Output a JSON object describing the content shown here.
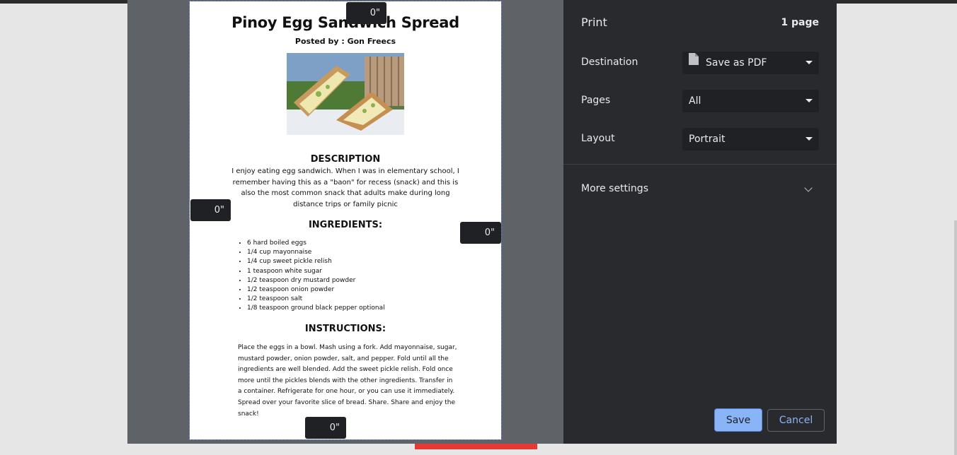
{
  "print_dialog": {
    "title": "Print",
    "page_count": "1 page",
    "destination": {
      "label": "Destination",
      "value": "Save as PDF"
    },
    "pages": {
      "label": "Pages",
      "value": "All"
    },
    "layout": {
      "label": "Layout",
      "value": "Portrait"
    },
    "more_settings": "More settings",
    "save_label": "Save",
    "cancel_label": "Cancel",
    "accent_color": "#8ab4f8"
  },
  "margins": {
    "top": "0\"",
    "left": "0\"",
    "right": "0\"",
    "bottom": "0\""
  },
  "document": {
    "title": "Pinoy Egg Sandwich Spread",
    "author": "Posted by : Gon Freecs",
    "description_heading": "DESCRIPTION",
    "description": "I enjoy eating egg sandwich. When I was in elementary school, I remember having this as a \"baon\" for recess (snack) and this is also the most common snack that adults make during long distance trips or family picnic",
    "ingredients_heading": "INGREDIENTS:",
    "ingredients": [
      "6 hard boiled eggs",
      "1/4 cup mayonnaise",
      "1/4 cup sweet pickle relish",
      "1 teaspoon white sugar",
      "1/2 teaspoon dry mustard powder",
      "1/2 teaspoon onion powder",
      "1/2 teaspoon salt",
      "1/8 teaspoon ground black pepper optional"
    ],
    "instructions_heading": "INSTRUCTIONS:",
    "instructions": "Place the eggs in a bowl. Mash using a fork. Add mayonnaise, sugar, mustard powder, onion powder, salt, and pepper. Fold until all the ingredients are well blended. Add the sweet pickle relish. Fold once more until the pickles blends with the other ingredients. Transfer in a container. Refrigerate for one hour, or you can use it immediately. Spread over your favorite slice of bread. Share. Share and enjoy the snack!"
  }
}
